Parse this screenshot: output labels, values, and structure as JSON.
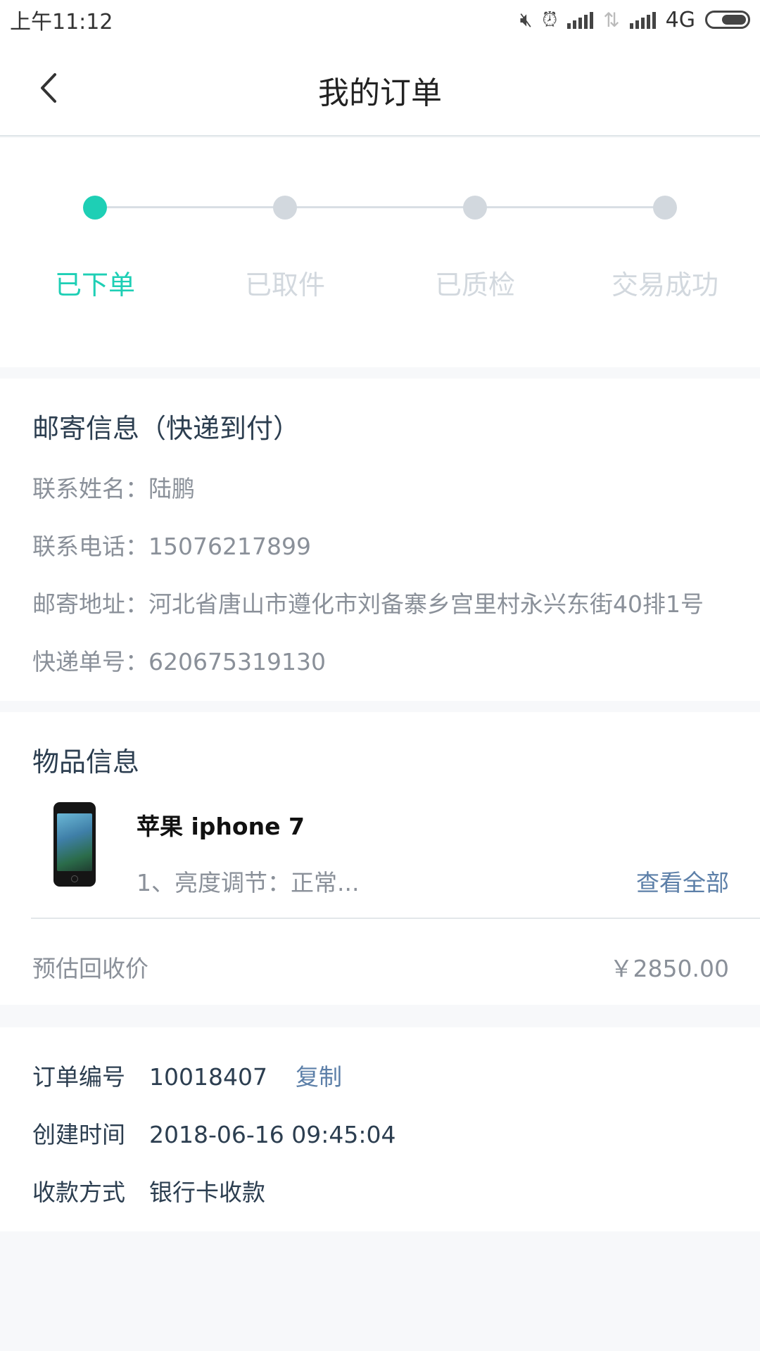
{
  "status_bar": {
    "time": "上午11:12",
    "network": "4G"
  },
  "header": {
    "title": "我的订单",
    "back_icon": "chevron-left-icon"
  },
  "steps": [
    {
      "label": "已下单",
      "active": true
    },
    {
      "label": "已取件",
      "active": false
    },
    {
      "label": "已质检",
      "active": false
    },
    {
      "label": "交易成功",
      "active": false
    }
  ],
  "shipping": {
    "title": "邮寄信息（快递到付）",
    "name_label": "联系姓名：",
    "name": "陆鹏",
    "phone_label": "联系电话：",
    "phone": "15076217899",
    "address_label": "邮寄地址：",
    "address": "河北省唐山市遵化市刘备寨乡宫里村永兴东街40排1号",
    "tracking_label": "快递单号：",
    "tracking": "620675319130"
  },
  "product": {
    "title": "物品信息",
    "name": "苹果 iphone 7",
    "desc": "1、亮度调节：正常...",
    "view_all": "查看全部",
    "price_label": "预估回收价",
    "price": "￥2850.00"
  },
  "order": {
    "number_label": "订单编号",
    "number": "10018407",
    "copy": "复制",
    "created_label": "创建时间",
    "created": "2018-06-16 09:45:04",
    "payment_label": "收款方式",
    "payment": "银行卡收款"
  },
  "colors": {
    "accent": "#1ecfb5",
    "link": "#5c7fa8",
    "inactive": "#d2d8de"
  }
}
